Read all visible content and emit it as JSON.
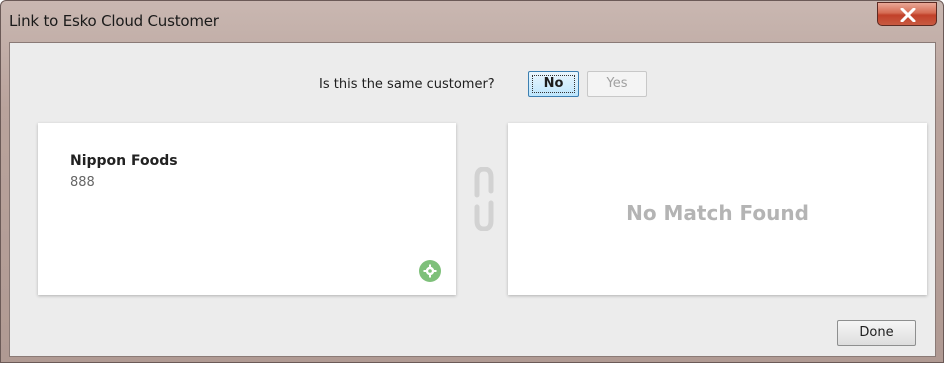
{
  "window": {
    "title": "Link to Esko Cloud Customer",
    "close_icon": "close-x-icon"
  },
  "prompt": {
    "question": "Is this the same customer?",
    "no_label": "No",
    "yes_label": "Yes"
  },
  "local_customer": {
    "name": "Nippon Foods",
    "code": "888",
    "action_icon": "gear-icon",
    "action_color": "#7ec07a"
  },
  "link_icon": "chain-link-icon",
  "cloud_match": {
    "status_text": "No Match Found"
  },
  "footer": {
    "done_label": "Done"
  }
}
